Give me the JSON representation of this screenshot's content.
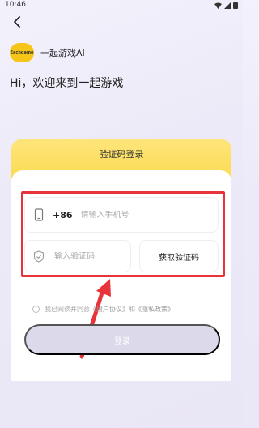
{
  "status": {
    "time": "10:46"
  },
  "brand": {
    "logo_text": "Eachgame",
    "name": "一起游戏AI"
  },
  "welcome": "Hi，欢迎来到一起游戏",
  "card": {
    "title": "验证码登录"
  },
  "phone": {
    "country_code": "+86",
    "placeholder": "请输入手机号"
  },
  "code": {
    "placeholder": "输入验证码",
    "get_code_label": "获取验证码"
  },
  "agreement": {
    "prefix": "我已阅读并同意",
    "user_agreement": "《用户协议》",
    "and": "和",
    "privacy_policy": "《隐私政策》"
  },
  "login_label": "登录",
  "colors": {
    "accent_yellow": "#fbd94a",
    "highlight_red": "#e8333a",
    "button_disabled": "#dcd9ea"
  }
}
